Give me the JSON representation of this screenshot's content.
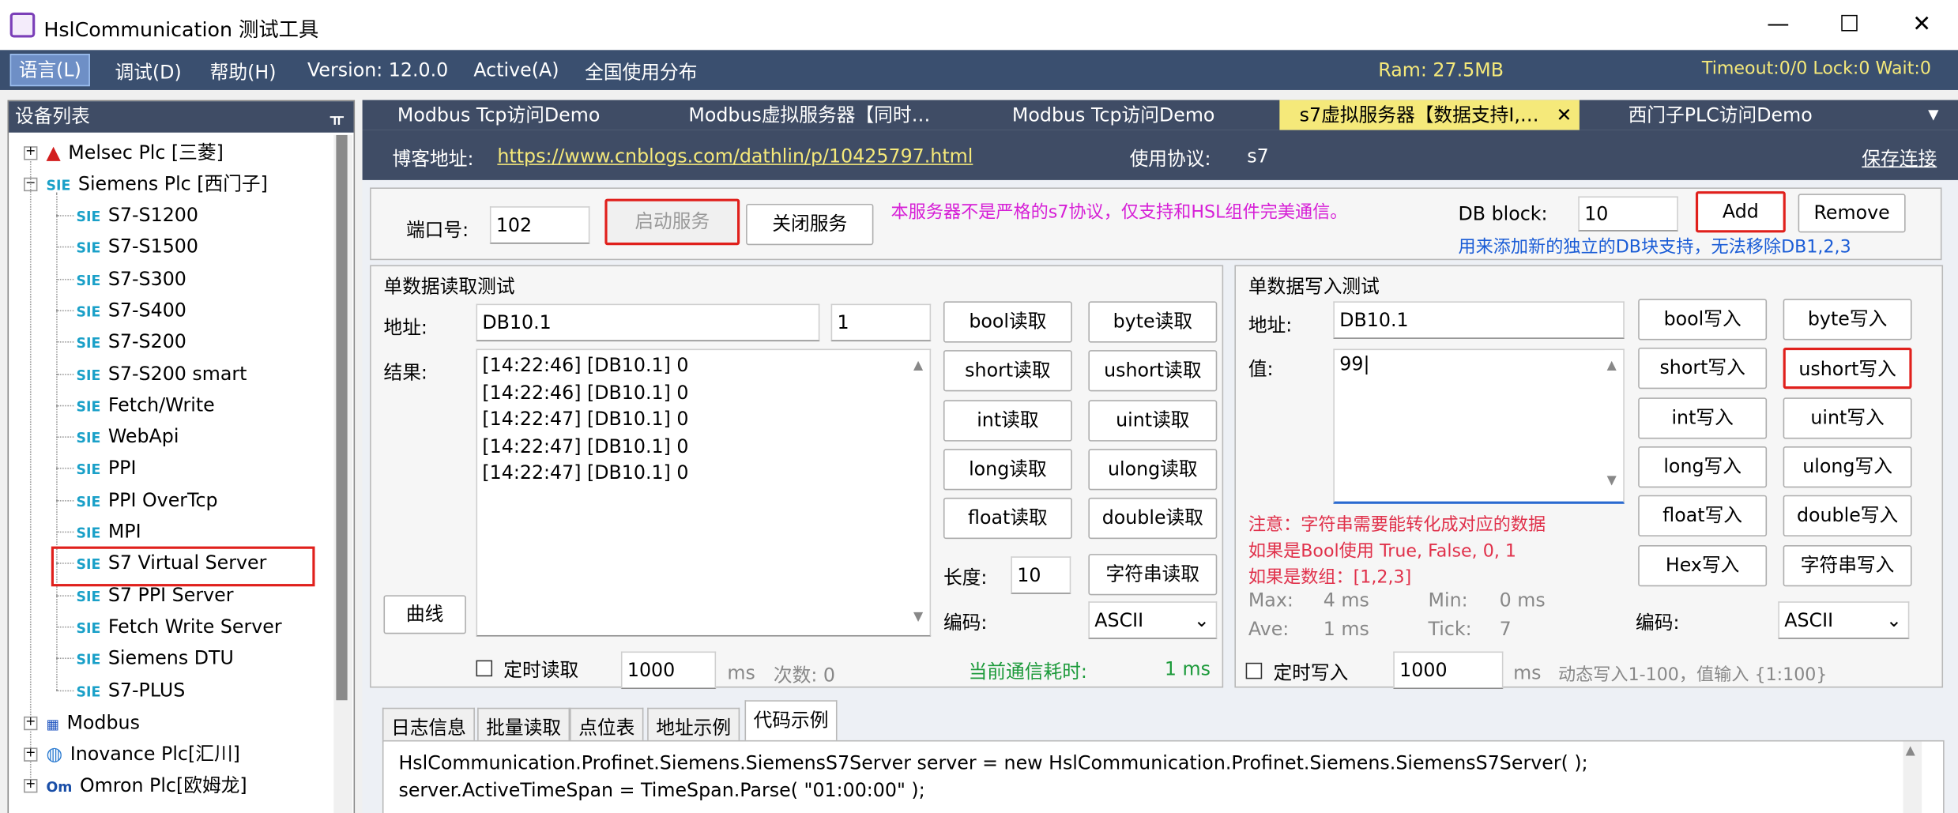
{
  "window": {
    "title": "HslCommunication 测试工具",
    "min": "—",
    "max": "☐",
    "close": "✕"
  },
  "menu": {
    "lang": "语言(L)",
    "debug": "调试(D)",
    "help": "帮助(H)",
    "version": "Version: 12.0.0",
    "active": "Active(A)",
    "global": "全国使用分布",
    "ram": "Ram: 27.5MB",
    "status": "Timeout:0/0  Lock:0  Wait:0"
  },
  "sidebar": {
    "title": "设备列表",
    "pin": "ᚂ",
    "groups": [
      {
        "label": "Melsec Plc [三菱]",
        "exp": "+"
      },
      {
        "label": "Siemens Plc [西门子]",
        "exp": "−"
      },
      {
        "label": "Modbus",
        "exp": "+"
      },
      {
        "label": "Inovance Plc[汇川]",
        "exp": "+"
      },
      {
        "label": "Omron Plc[欧姆龙]",
        "exp": "+"
      }
    ],
    "siemens": [
      "S7-S1200",
      "S7-S1500",
      "S7-S300",
      "S7-S400",
      "S7-S200",
      "S7-S200 smart",
      "Fetch/Write",
      "WebApi",
      "PPI",
      "PPI OverTcp",
      "MPI",
      "S7 Virtual Server",
      "S7 PPI Server",
      "Fetch Write Server",
      "Siemens DTU",
      "S7-PLUS"
    ],
    "sie": "SIE"
  },
  "tabs": [
    "Modbus Tcp访问Demo",
    "Modbus虚拟服务器【同时…",
    "Modbus Tcp访问Demo",
    "s7虚拟服务器【数据支持I,…",
    "西门子PLC访问Demo"
  ],
  "tab_close": "✕",
  "tab_menu": "▼",
  "blog": {
    "label": "博客地址:",
    "url": "https://www.cnblogs.com/dathlin/p/10425797.html",
    "proto_label": "使用协议:",
    "proto": "s7",
    "save": "保存连接"
  },
  "server": {
    "port_label": "端口号:",
    "port": "102",
    "start": "启动服务",
    "stop": "关闭服务",
    "note": "本服务器不是严格的s7协议，仅支持和HSL组件完美通信。",
    "db_label": "DB block:",
    "db": "10",
    "add": "Add",
    "remove": "Remove",
    "db_note": "用来添加新的独立的DB块支持，无法移除DB1,2,3"
  },
  "read": {
    "title": "单数据读取测试",
    "addr_label": "地址:",
    "addr": "DB10.1",
    "len_short": "1",
    "result_label": "结果:",
    "results": [
      "[14:22:46] [DB10.1] 0",
      "[14:22:46] [DB10.1] 0",
      "[14:22:47] [DB10.1] 0",
      "[14:22:47] [DB10.1] 0",
      "[14:22:47] [DB10.1] 0"
    ],
    "buttons": [
      "bool读取",
      "byte读取",
      "short读取",
      "ushort读取",
      "int读取",
      "uint读取",
      "long读取",
      "ulong读取",
      "float读取",
      "double读取"
    ],
    "len_label": "长度:",
    "len": "10",
    "string_btn": "字符串读取",
    "enc_label": "编码:",
    "enc": "ASCII",
    "curve": "曲线",
    "timer": "定时读取",
    "interval": "1000",
    "ms": "ms",
    "count": "次数: 0",
    "cost_label": "当前通信耗时:",
    "cost": "1 ms"
  },
  "write": {
    "title": "单数据写入测试",
    "addr_label": "地址:",
    "addr": "DB10.1",
    "val_label": "值:",
    "val": "99",
    "buttons": [
      "bool写入",
      "byte写入",
      "short写入",
      "ushort写入",
      "int写入",
      "uint写入",
      "long写入",
      "ulong写入",
      "float写入",
      "double写入",
      "Hex写入",
      "字符串写入"
    ],
    "notes": [
      "注意：字符串需要能转化成对应的数据",
      "如果是Bool使用 True, False, 0, 1",
      "如果是数组：[1,2,3]"
    ],
    "max_label": "Max:",
    "max": "4 ms",
    "min_label": "Min:",
    "min": "0 ms",
    "ave_label": "Ave:",
    "ave": "1 ms",
    "tick_label": "Tick:",
    "tick": "7",
    "enc_label": "编码:",
    "enc": "ASCII",
    "timer": "定时写入",
    "interval": "1000",
    "ms": "ms",
    "dyn": "动态写入1-100，值输入 {1:100}"
  },
  "bottom_tabs": [
    "日志信息",
    "批量读取",
    "点位表",
    "地址示例",
    "代码示例"
  ],
  "code": [
    "HslCommunication.Profinet.Siemens.SiemensS7Server server = new HslCommunication.Profinet.Siemens.SiemensS7Server( );",
    "server.ActiveTimeSpan = TimeSpan.Parse( \"01:00:00\" );"
  ],
  "colors": {
    "menubar": "#3a4f6f",
    "active_tab": "#f5e97a",
    "highlight": "#e0201c",
    "note": "#d61fd6",
    "link": "#1a5cd6"
  }
}
